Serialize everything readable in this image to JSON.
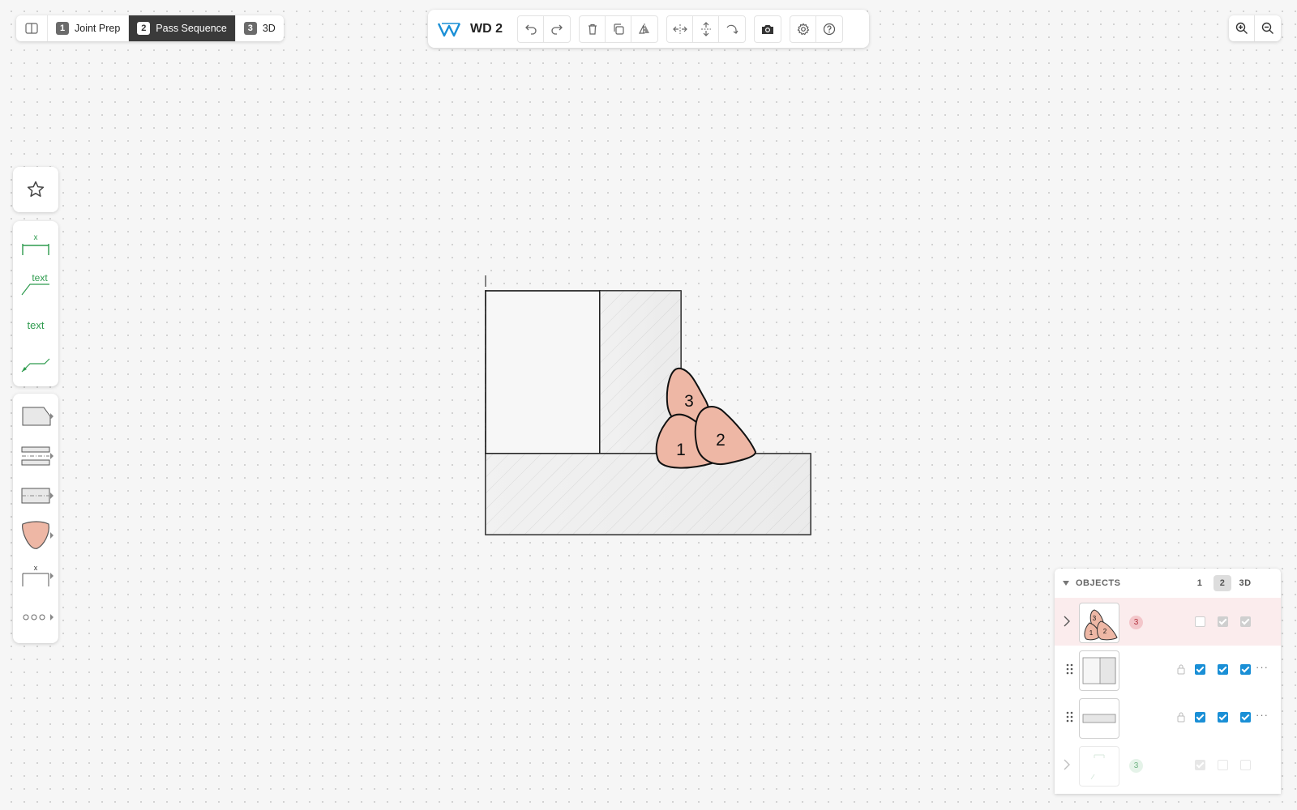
{
  "steps": {
    "items": [
      {
        "num": "1",
        "label": "Joint Prep",
        "active": false
      },
      {
        "num": "2",
        "label": "Pass Sequence",
        "active": true
      },
      {
        "num": "3",
        "label": "3D",
        "active": false
      }
    ]
  },
  "toolbar": {
    "title": "WD 2",
    "logo_icon": "wd-logo-icon",
    "accent": "#1a8fd6"
  },
  "sidebar": {
    "tools": [
      {
        "name": "dimension-tool",
        "label": "x"
      },
      {
        "name": "leader-text-tool",
        "label": "text"
      },
      {
        "name": "text-tool",
        "label": "text"
      },
      {
        "name": "leader-tool",
        "label": ""
      }
    ]
  },
  "drawing": {
    "passes": [
      "1",
      "2",
      "3"
    ],
    "bead_fill": "#eeb7a5",
    "annotation_color": "#2e9b4e"
  },
  "objects": {
    "title": "OBJECTS",
    "columns": [
      "1",
      "2",
      "3D"
    ],
    "active_column": "2",
    "rows": [
      {
        "thumb": "weld-passes",
        "count": "3",
        "badge_color": "#e79aa0",
        "checks": [
          "off",
          "grey",
          "grey"
        ],
        "highlight": true
      },
      {
        "thumb": "vertical-plate",
        "count": "",
        "checks": [
          "on",
          "on",
          "on"
        ],
        "highlight": false
      },
      {
        "thumb": "horizontal-plate",
        "count": "",
        "checks": [
          "on",
          "on",
          "on"
        ],
        "highlight": false
      },
      {
        "thumb": "annotations",
        "count": "3",
        "badge_color": "#a9d9b5",
        "checks": [
          "grey",
          "off",
          "off"
        ],
        "highlight": false
      }
    ],
    "thumb_labels": [
      "3",
      "1",
      "2"
    ]
  }
}
